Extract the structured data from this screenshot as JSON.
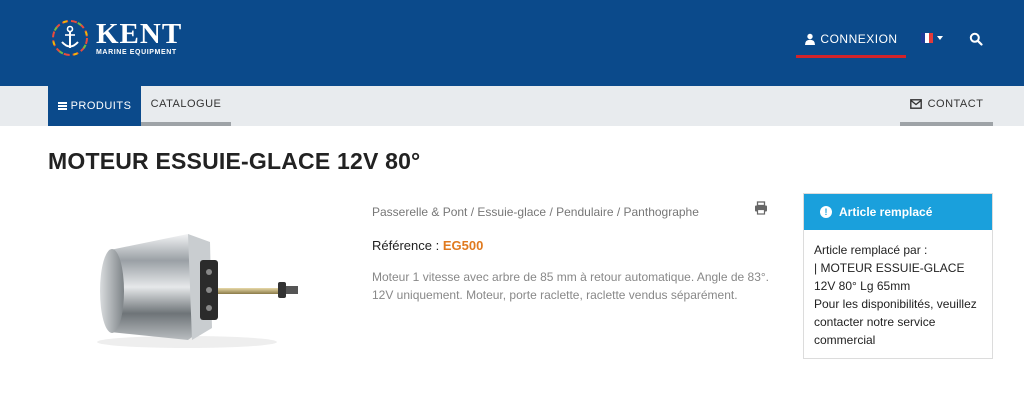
{
  "brand": {
    "name": "KENT",
    "tagline": "MARINE EQUIPMENT",
    "colors": {
      "header": "#0b4a8b",
      "accent_red": "#d2232a",
      "info_blue": "#1aa0dc",
      "reference_orange": "#e07a1f"
    }
  },
  "header": {
    "login_label": "CONNEXION",
    "login_icon": "user-icon",
    "language_icon": "french-flag-icon",
    "search_icon": "search-icon"
  },
  "subnav": {
    "products_label": "PRODUITS",
    "catalogue_label": "CATALOGUE",
    "contact_label": "CONTACT"
  },
  "product": {
    "title": "MOTEUR ESSUIE-GLACE 12V 80°",
    "breadcrumb": [
      "Passerelle & Pont",
      "Essuie-glace",
      "Pendulaire / Panthographe"
    ],
    "breadcrumb_sep": " / ",
    "reference_label": "Référence : ",
    "reference_value": "EG500",
    "description": "Moteur 1 vitesse avec arbre de 85 mm à retour automatique. Angle de 83°. 12V uniquement. Moteur, porte raclette, raclette vendus séparément."
  },
  "replaced": {
    "heading": "Article remplacé",
    "intro": "Article remplacé par :",
    "link_text": "| MOTEUR ESSUIE-GLACE 12V 80° Lg 65mm",
    "note": "Pour les disponibilités, veuillez contacter notre service commercial"
  }
}
